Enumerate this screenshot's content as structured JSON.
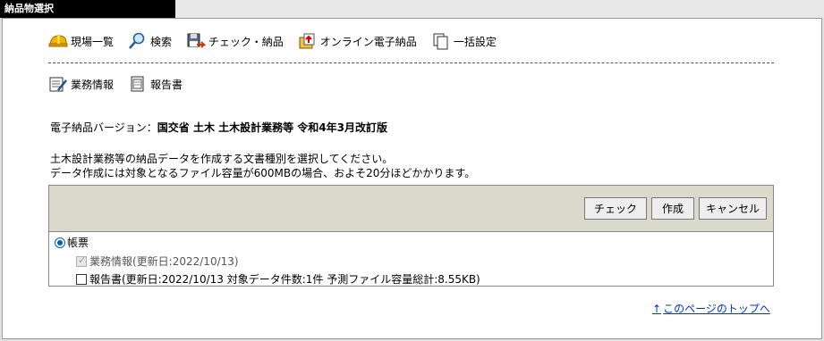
{
  "window": {
    "title": "納品物選択"
  },
  "menu_primary": [
    {
      "name": "site-list",
      "label": "現場一覧",
      "icon": "helmet-icon"
    },
    {
      "name": "search",
      "label": "検索",
      "icon": "magnifier-icon"
    },
    {
      "name": "check-deliver",
      "label": "チェック・納品",
      "icon": "save-disk-icon"
    },
    {
      "name": "online-deliver",
      "label": "オンライン電子納品",
      "icon": "online-upload-icon"
    },
    {
      "name": "bulk-settings",
      "label": "一括設定",
      "icon": "documents-icon"
    }
  ],
  "menu_secondary": [
    {
      "name": "work-info",
      "label": "業務情報",
      "icon": "notepad-pen-icon"
    },
    {
      "name": "report",
      "label": "報告書",
      "icon": "report-book-icon"
    }
  ],
  "version": {
    "prefix": "電子納品バージョン：",
    "value": "国交省 土木 土木設計業務等 令和4年3月改訂版"
  },
  "description": [
    "土木設計業務等の納品データを作成する文書種別を選択してください。",
    "データ作成には対象となるファイル容量が600MBの場合、およそ20分ほどかかります。"
  ],
  "buttons": {
    "check": "チェック",
    "create": "作成",
    "cancel": "キャンセル"
  },
  "options": {
    "radio_label": "帳票",
    "item1": "業務情報(更新日:2022/10/13)",
    "item2": "報告書(更新日:2022/10/13  対象データ件数:1件  予測ファイル容量総計:8.55KB)"
  },
  "footer": {
    "arrow": "↑",
    "top_link": "このページのトップへ"
  },
  "colors": {
    "accent": "#0033cc",
    "panel_head": "#d9d9cc",
    "title_bg": "#000000"
  }
}
